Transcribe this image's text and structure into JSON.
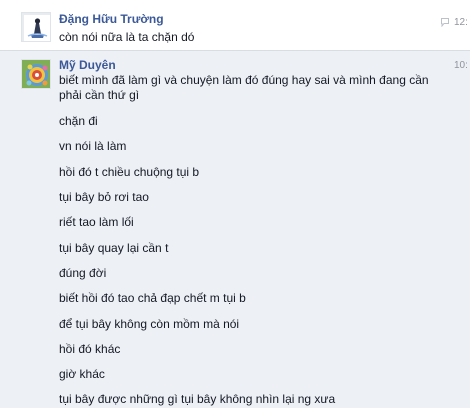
{
  "conversation": {
    "messages": [
      {
        "author": "Đặng Hữu Trường",
        "time": "12:",
        "lines": [
          "còn nói nữa là ta chặn dó"
        ]
      },
      {
        "author": "Mỹ Duyên",
        "time": "10:",
        "lines": [
          "biết mình đã làm gì và chuyện làm đó đúng hay sai và mình đang cần",
          "phải cần thứ gì",
          "chặn đi",
          "vn nói là làm",
          "hồi đó t chiều chuộng tụi b",
          "tụi bây bỏ rơi tao",
          "riết tao làm lối",
          "tụi bây quay lại cần t",
          "đúng đời",
          "biết hồi đó tao chả đạp chết m tụi b",
          "để tụi bây không còn mồm mà nói",
          "hồi đó khác",
          "giờ khác",
          "tụi bây được những gì tụi bây không nhìn lại ng xưa"
        ]
      }
    ]
  }
}
